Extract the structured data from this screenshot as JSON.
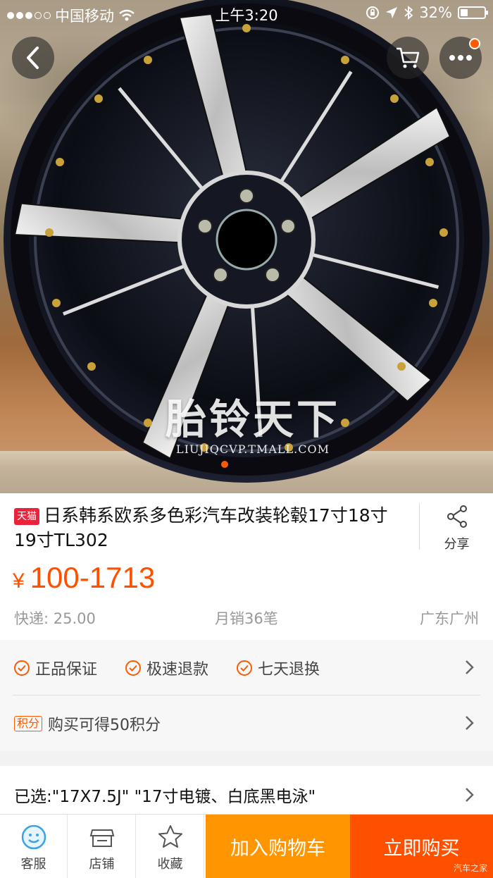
{
  "status_bar": {
    "carrier": "中国移动",
    "time": "上午3:20",
    "battery": "32%",
    "battery_level": 0.32
  },
  "hero": {
    "watermark_cn": "胎铃天下",
    "watermark_url": "LIUJIQCVP.TMALL.COM"
  },
  "product": {
    "tag": "天猫",
    "title": "日系韩系欧系多色彩汽车改装轮毂17寸18寸19寸TL302",
    "share_label": "分享",
    "price_symbol": "¥",
    "price_range": "100-1713",
    "shipping": "快递: 25.00",
    "monthly_sales": "月销36笔",
    "location": "广东广州"
  },
  "services": {
    "items": [
      "正品保证",
      "极速退款",
      "七天退换"
    ],
    "points_tag": "积分",
    "points_text": "购买可得50积分"
  },
  "selection": {
    "text": "已选:\"17X7.5J\" \"17寸电镀、白底黑电泳\""
  },
  "bottom_bar": {
    "service": "客服",
    "store": "店铺",
    "favorite": "收藏",
    "add_to_cart": "加入购物车",
    "buy_now": "立即购买",
    "corner_watermark": "汽车之家"
  },
  "colors": {
    "accent": "#ff5000",
    "cart_button": "#ff9500",
    "tmall_red": "#e8233b"
  }
}
